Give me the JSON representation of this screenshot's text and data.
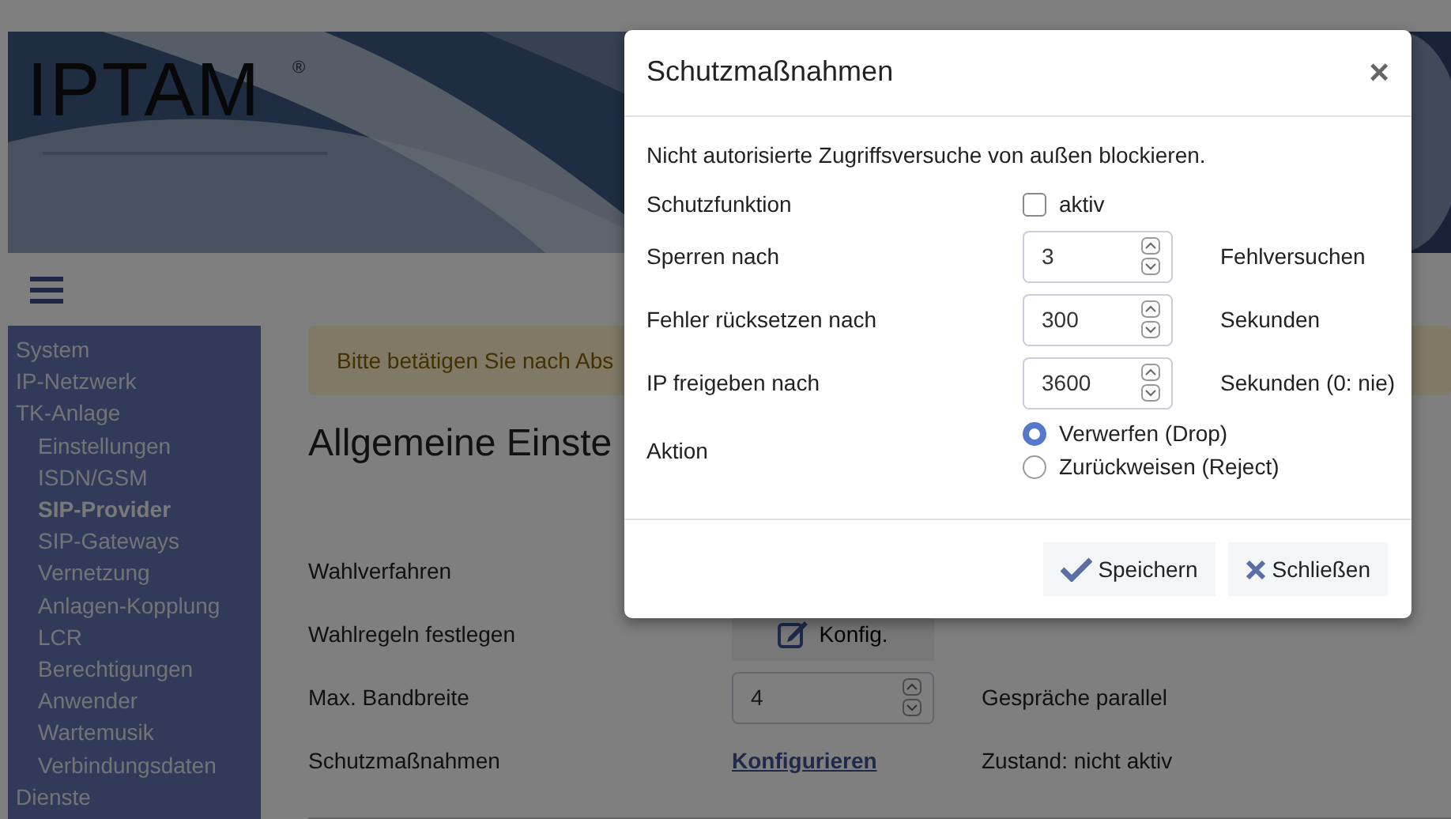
{
  "header": {
    "logo": "IPTAM",
    "logo_mark": "®"
  },
  "sidebar": {
    "items": [
      {
        "label": "System",
        "selected": false
      },
      {
        "label": "IP-Netzwerk",
        "selected": false
      },
      {
        "label": "TK-Anlage",
        "selected": false,
        "children": [
          {
            "label": "Einstellungen",
            "selected": false
          },
          {
            "label": "ISDN/GSM",
            "selected": false
          },
          {
            "label": "SIP-Provider",
            "selected": true
          },
          {
            "label": "SIP-Gateways",
            "selected": false
          },
          {
            "label": "Vernetzung",
            "selected": false
          },
          {
            "label": "Anlagen-Kopplung",
            "selected": false
          },
          {
            "label": "LCR",
            "selected": false
          },
          {
            "label": "Berechtigungen",
            "selected": false
          },
          {
            "label": "Anwender",
            "selected": false
          },
          {
            "label": "Wartemusik",
            "selected": false
          },
          {
            "label": "Verbindungsdaten",
            "selected": false
          }
        ]
      },
      {
        "label": "Dienste",
        "selected": false
      }
    ]
  },
  "main": {
    "alert": "Bitte betätigen Sie nach Abs",
    "heading": "Allgemeine Einste",
    "rows": [
      {
        "kind": "plain",
        "label": "Wahlverfahren"
      },
      {
        "kind": "button",
        "label": "Wahlregeln festlegen",
        "button": "Konfig."
      },
      {
        "kind": "number",
        "label": "Max. Bandbreite",
        "value": "4",
        "unit": "Gespräche parallel"
      },
      {
        "kind": "link",
        "label": "Schutzmaßnahmen",
        "link": "Konfigurieren",
        "status": "Zustand: nicht aktiv"
      }
    ]
  },
  "modal": {
    "title": "Schutzmaßnahmen",
    "close": "×",
    "intro": "Nicht autorisierte Zugriffsversuche von außen blockieren.",
    "fields": [
      {
        "kind": "checkbox",
        "label": "Schutzfunktion",
        "option": "aktiv",
        "checked": false
      },
      {
        "kind": "number",
        "label": "Sperren nach",
        "value": "3",
        "unit": "Fehlversuchen"
      },
      {
        "kind": "number",
        "label": "Fehler rücksetzen nach",
        "value": "300",
        "unit": "Sekunden"
      },
      {
        "kind": "number",
        "label": "IP freigeben nach",
        "value": "3600",
        "unit": "Sekunden (0: nie)"
      },
      {
        "kind": "radio",
        "label": "Aktion",
        "options": [
          {
            "label": "Verwerfen (Drop)",
            "selected": true
          },
          {
            "label": "Zurückweisen (Reject)",
            "selected": false
          }
        ]
      }
    ],
    "buttons": [
      {
        "kind": "save",
        "label": "Speichern"
      },
      {
        "kind": "close",
        "label": "Schließen"
      }
    ]
  }
}
